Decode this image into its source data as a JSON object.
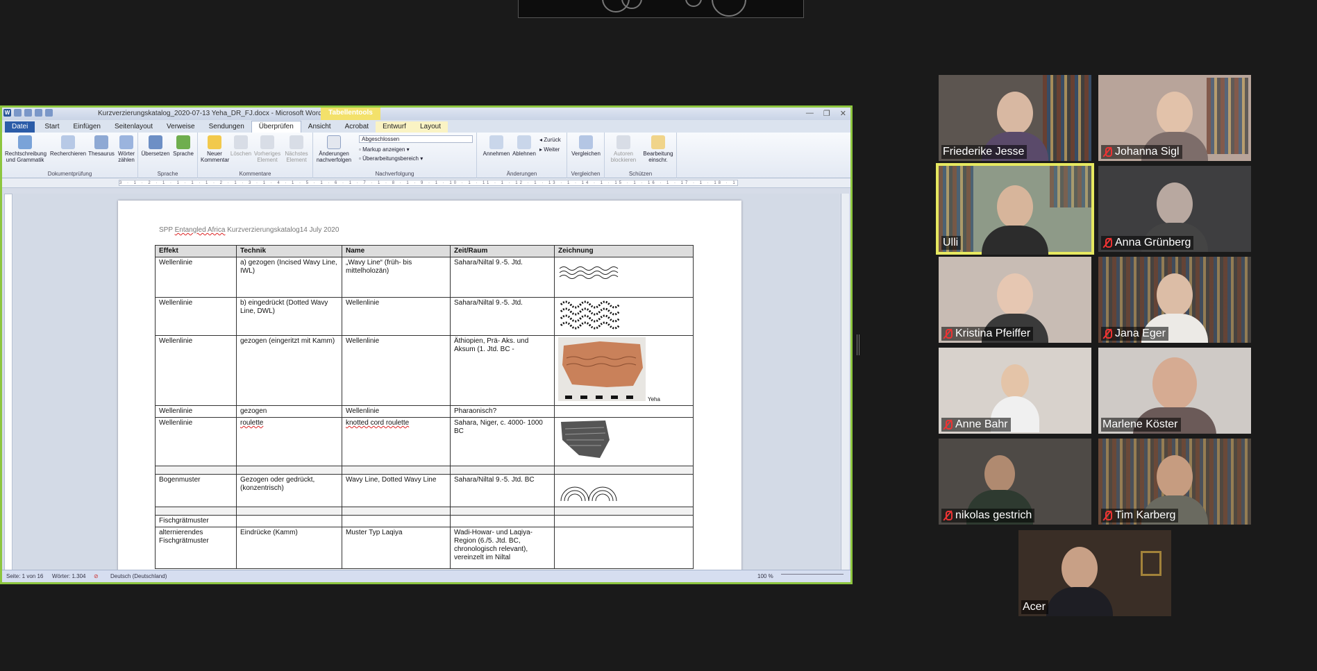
{
  "word": {
    "window_title": "Kurzverzierungskatalog_2020-07-13 Yeha_DR_FJ.docx  -  Microsoft Word",
    "contextual_tab_group": "Tabellentools",
    "tabs": [
      "Datei",
      "Start",
      "Einfügen",
      "Seitenlayout",
      "Verweise",
      "Sendungen",
      "Überprüfen",
      "Ansicht",
      "Acrobat",
      "Entwurf",
      "Layout"
    ],
    "active_tab": "Überprüfen",
    "ribbon": {
      "groups": [
        "Dokumentprüfung",
        "Sprache",
        "Kommentare",
        "Nachverfolgung",
        "Änderungen",
        "Vergleichen",
        "Schützen"
      ],
      "buttons": {
        "rechtschreibung": "Rechtschreibung und Grammatik",
        "recherchieren": "Recherchieren",
        "thesaurus": "Thesaurus",
        "woerter": "Wörter zählen",
        "uebersetzen": "Übersetzen",
        "sprache": "Sprache",
        "neuer_kommentar": "Neuer Kommentar",
        "loeschen": "Löschen",
        "vorheriges": "Vorheriges Element",
        "naechstes": "Nächstes Element",
        "aenderungen_nachverfolgen": "Änderungen nachverfolgen",
        "abgeschlossen": "Abgeschlossen",
        "markup": "Markup anzeigen",
        "ueberarbeitungsbereich": "Überarbeitungsbereich",
        "annehmen": "Annehmen",
        "ablehnen": "Ablehnen",
        "zurueck": "Zurück",
        "weiter": "Weiter",
        "vergleichen": "Vergleichen",
        "autoren_blockieren": "Autoren blockieren",
        "bearbeitung_einschr": "Bearbeitung einschr."
      }
    },
    "ruler_text": "3 · 1 · 2 · 1 · 1 · 1 · 1 · 2 · 1 · 3 · 1 · 4 · 1 · 5 · 1 · 6 · 1 · 7 · 1 · 8 · 1 · 9 · 1 · 10 · 1 · 11 · 1 · 12 · 1 · 13 · 1 · 14 · 1 · 15 · 1 · 16 · 1 · 17 · 1 · 18 · 1 · 19 · 1 · 20 · 1 · 21 · 1 · 22 · 1 · 23 · 1 · 24 · 1 · 25 · 1 · 26 · 1 · 27",
    "header": {
      "prefix": "SPP ",
      "entangled": "Entangled Africa",
      "rest": " Kurzverzierungskatalog14 July 2020"
    },
    "table": {
      "headers": [
        "Effekt",
        "Technik",
        "Name",
        "Zeit/Raum",
        "Zeichnung"
      ],
      "rows": [
        {
          "effekt": "Wellenlinie",
          "technik": "a)  gezogen  (Incised  Wavy Line, IWL)",
          "name": "„Wavy Line“ (früh- bis mittelholozän)",
          "zeit": "Sahara/Niltal 9.-5. Jtd."
        },
        {
          "effekt": "Wellenlinie",
          "technik": "b) eingedrückt (Dotted Wavy Line, DWL)",
          "name": "Wellenlinie",
          "zeit": "Sahara/Niltal 9.-5. Jtd."
        },
        {
          "effekt": "Wellenlinie",
          "technik": "gezogen (eingeritzt mit Kamm)",
          "name": "Wellenlinie",
          "zeit": "Äthiopien,  Prä- Aks. und Aksum (1. Jtd. BC -",
          "caption": "Yeha"
        },
        {
          "effekt": "Wellenlinie",
          "technik": "gezogen",
          "name": "Wellenlinie",
          "zeit": "Pharaonisch?"
        },
        {
          "effekt": "Wellenlinie",
          "technik": "roulette",
          "name": "knotted cord roulette",
          "zeit": "Sahara, Niger, c. 4000- 1000 BC"
        },
        {
          "effekt": "Bogenmuster",
          "technik": "Gezogen oder gedrückt, (konzentrisch)",
          "name": "Wavy Line, Dotted Wavy Line",
          "zeit": "Sahara/Niltal 9.-5. Jtd. BC"
        },
        {
          "effekt": "Fischgrätmuster",
          "technik": "",
          "name": "",
          "zeit": ""
        },
        {
          "effekt": "alternierendes Fischgrätmuster",
          "technik": "Eindrücke (Kamm)",
          "name": "Muster Typ Laqiya",
          "zeit": "Wadi-Howar- und Laqiya-Region (6./5. Jtd. BC, chronologisch relevant), vereinzelt im Niltal"
        }
      ]
    },
    "status": {
      "page": "Seite: 1 von 16",
      "words": "Wörter: 1.304",
      "language": "Deutsch (Deutschland)",
      "zoom": "100 %"
    }
  },
  "participants": [
    {
      "name": "Friederike Jesse",
      "muted": false
    },
    {
      "name": "Johanna Sigl",
      "muted": true
    },
    {
      "name": "Ulli",
      "muted": false,
      "speaking": true
    },
    {
      "name": "Anna Grünberg",
      "muted": true
    },
    {
      "name": "Kristina Pfeiffer",
      "muted": true
    },
    {
      "name": "Jana Eger",
      "muted": true
    },
    {
      "name": "Anne Bahr",
      "muted": true
    },
    {
      "name": "Marlene Köster",
      "muted": false
    },
    {
      "name": "nikolas gestrich",
      "muted": true
    },
    {
      "name": "Tim Karberg",
      "muted": true
    },
    {
      "name": "Acer",
      "muted": false
    }
  ]
}
